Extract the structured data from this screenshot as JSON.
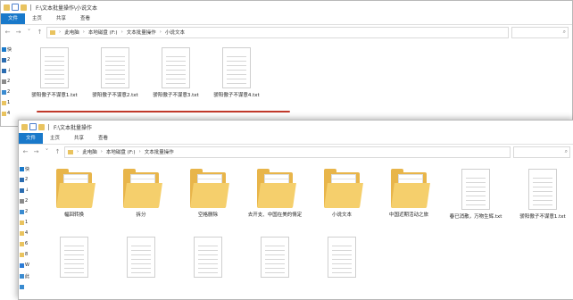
{
  "back_window": {
    "title": "F:\\文本批量操作\\小说文本",
    "ribbon_tabs": [
      "文件",
      "主页",
      "共享",
      "查看"
    ],
    "breadcrumb": [
      "此电脑",
      "本地磁盘 (F:)",
      "文本批量操作",
      "小说文本"
    ],
    "nav_items": [
      {
        "label": "快",
        "icon": "star-icon",
        "color": "#1979ca"
      },
      {
        "label": "2",
        "icon": "desktop-icon",
        "color": "#2b6cb0"
      },
      {
        "label": "↓",
        "icon": "download-icon",
        "color": "#2b6cb0"
      },
      {
        "label": "2",
        "icon": "document-icon",
        "color": "#8a8a8a"
      },
      {
        "label": "2",
        "icon": "picture-icon",
        "color": "#3a8bd0"
      },
      {
        "label": "1",
        "icon": "folder-icon",
        "color": "#e9c35f"
      },
      {
        "label": "4",
        "icon": "folder-icon",
        "color": "#e9c35f"
      }
    ],
    "files": [
      {
        "name": "骄阳傲子不谋意1.txt"
      },
      {
        "name": "骄阳傲子不谋意2.txt"
      },
      {
        "name": "骄阳傲子不谋意3.txt"
      },
      {
        "name": "骄阳傲子不谋意4.txt"
      }
    ],
    "highlight_color": "#c0392b"
  },
  "front_window": {
    "title": "F:\\文本批量操作",
    "ribbon_tabs": [
      "文件",
      "主页",
      "共享",
      "查看"
    ],
    "breadcrumb": [
      "此电脑",
      "本地磁盘 (F:)",
      "文本批量操作"
    ],
    "nav_items": [
      {
        "label": "快",
        "icon": "star-icon",
        "color": "#1979ca"
      },
      {
        "label": "2",
        "icon": "desktop-icon",
        "color": "#2b6cb0"
      },
      {
        "label": "↓",
        "icon": "download-icon",
        "color": "#2b6cb0"
      },
      {
        "label": "2",
        "icon": "document-icon",
        "color": "#8a8a8a"
      },
      {
        "label": "2",
        "icon": "picture-icon",
        "color": "#3a8bd0"
      },
      {
        "label": "1",
        "icon": "folder-icon",
        "color": "#e9c35f"
      },
      {
        "label": "4",
        "icon": "folder-icon",
        "color": "#e9c35f"
      },
      {
        "label": "6",
        "icon": "folder-icon",
        "color": "#e9c35f"
      },
      {
        "label": "8",
        "icon": "folder-icon",
        "color": "#e9c35f"
      },
      {
        "label": "W",
        "icon": "cloud-icon",
        "color": "#2b7bd6"
      },
      {
        "label": "此",
        "icon": "computer-icon",
        "color": "#3a8bd0"
      },
      {
        "label": "",
        "icon": "cube-icon",
        "color": "#3a8bd0"
      }
    ],
    "items": [
      {
        "name": "幅回转换",
        "type": "folder"
      },
      {
        "name": "拆分",
        "type": "folder"
      },
      {
        "name": "空格删除",
        "type": "folder"
      },
      {
        "name": "去开支、中国在美的情定",
        "type": "folder"
      },
      {
        "name": "小说文本",
        "type": "folder"
      },
      {
        "name": "中国近期活动之旅",
        "type": "folder"
      },
      {
        "name": "春已消散，万物生辉.txt",
        "type": "file"
      },
      {
        "name": "骄阳傲子不谋意1.txt",
        "type": "file"
      },
      {
        "name": "",
        "type": "file"
      },
      {
        "name": "",
        "type": "file"
      },
      {
        "name": "",
        "type": "file"
      },
      {
        "name": "",
        "type": "file"
      },
      {
        "name": "",
        "type": "file"
      }
    ]
  }
}
